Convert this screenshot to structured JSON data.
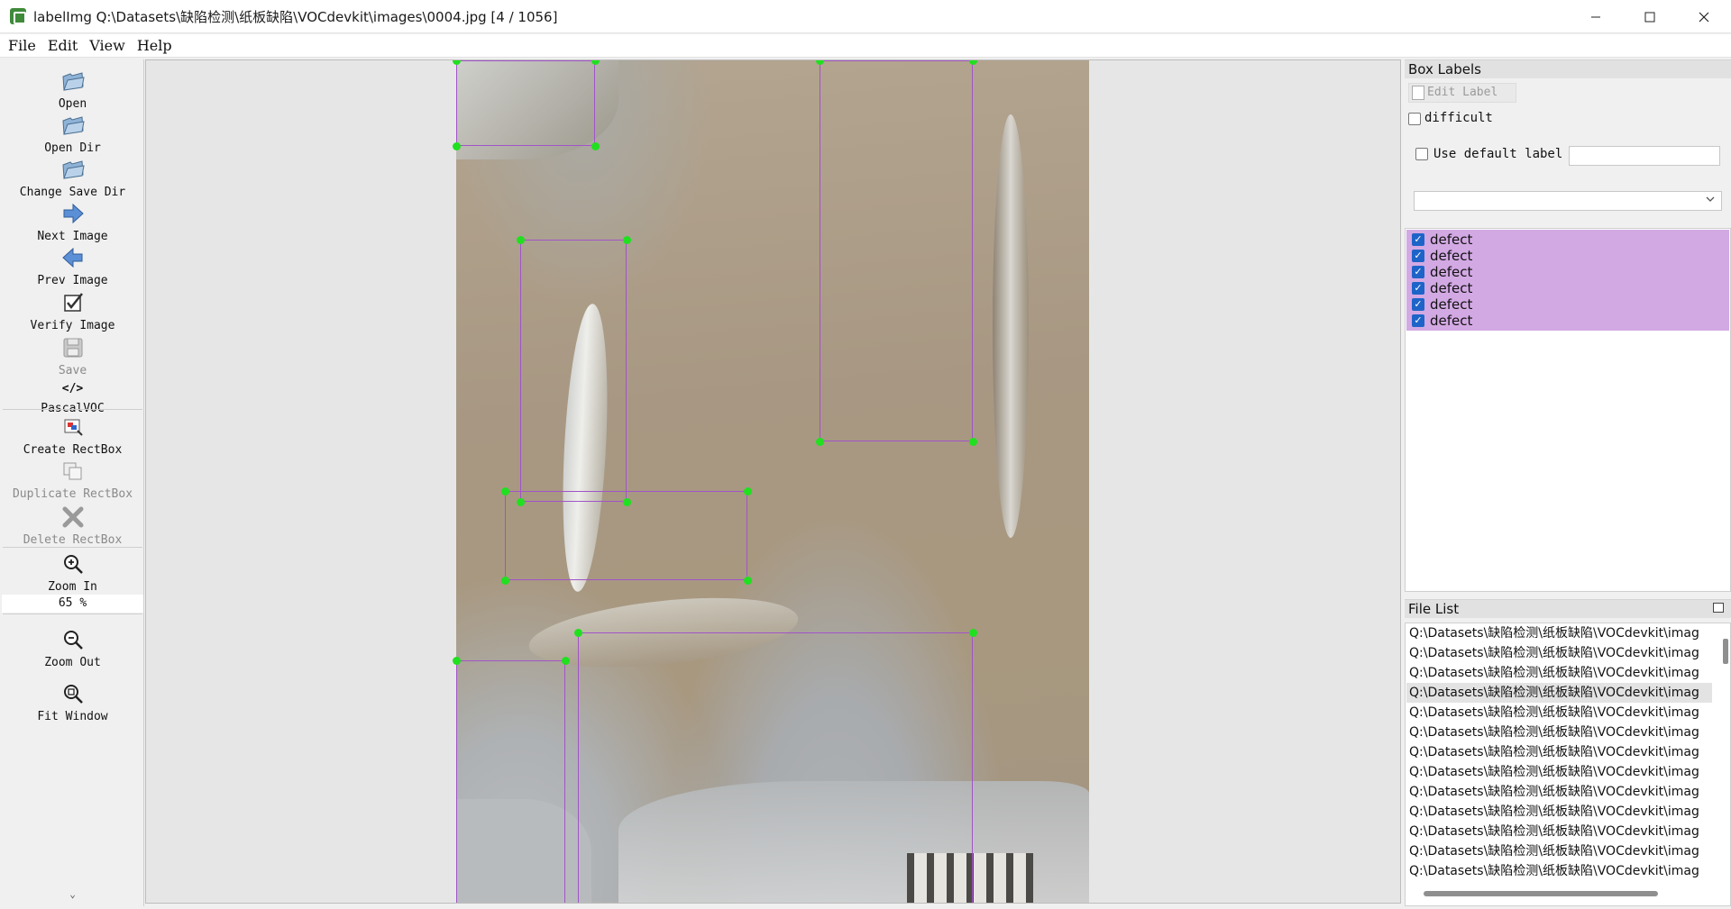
{
  "window": {
    "title": "labelImg Q:\\Datasets\\缺陷检测\\纸板缺陷\\VOCdevkit\\images\\0004.jpg [4 / 1056]",
    "controls": [
      "minimize",
      "maximize",
      "close"
    ]
  },
  "menu": {
    "file": "File",
    "edit": "Edit",
    "view": "View",
    "help": "Help"
  },
  "toolbar": {
    "open": "Open",
    "open_dir": "Open Dir",
    "change_save_dir": "Change Save Dir",
    "next_image": "Next Image",
    "prev_image": "Prev Image",
    "verify_image": "Verify Image",
    "save": "Save",
    "format_icon": "</>",
    "format": "PascalVOC",
    "create_rectbox": "Create RectBox",
    "duplicate_rectbox": "Duplicate RectBox",
    "delete_rectbox": "Delete RectBox",
    "zoom_in": "Zoom In",
    "zoom_value": "65 %",
    "zoom_out": "Zoom Out",
    "fit_window": "Fit Window",
    "more_icon": "⌄"
  },
  "box_labels": {
    "title": "Box Labels",
    "edit_label": "Edit Label",
    "difficult": "difficult",
    "use_default_label": "Use default label",
    "default_label_value": "",
    "labels": [
      "defect",
      "defect",
      "defect",
      "defect",
      "defect",
      "defect"
    ]
  },
  "file_list": {
    "title": "File List",
    "items": [
      "Q:\\Datasets\\缺陷检测\\纸板缺陷\\VOCdevkit\\imag",
      "Q:\\Datasets\\缺陷检测\\纸板缺陷\\VOCdevkit\\imag",
      "Q:\\Datasets\\缺陷检测\\纸板缺陷\\VOCdevkit\\imag",
      "Q:\\Datasets\\缺陷检测\\纸板缺陷\\VOCdevkit\\imag",
      "Q:\\Datasets\\缺陷检测\\纸板缺陷\\VOCdevkit\\imag",
      "Q:\\Datasets\\缺陷检测\\纸板缺陷\\VOCdevkit\\imag",
      "Q:\\Datasets\\缺陷检测\\纸板缺陷\\VOCdevkit\\imag",
      "Q:\\Datasets\\缺陷检测\\纸板缺陷\\VOCdevkit\\imag",
      "Q:\\Datasets\\缺陷检测\\纸板缺陷\\VOCdevkit\\imag",
      "Q:\\Datasets\\缺陷检测\\纸板缺陷\\VOCdevkit\\imag",
      "Q:\\Datasets\\缺陷检测\\纸板缺陷\\VOCdevkit\\imag",
      "Q:\\Datasets\\缺陷检测\\纸板缺陷\\VOCdevkit\\imag",
      "Q:\\Datasets\\缺陷检测\\纸板缺陷\\VOCdevkit\\imag"
    ]
  },
  "colors": {
    "box_outline": "#a154c8",
    "handle": "#20e020",
    "label_row_bg": "#d3a9e4"
  }
}
